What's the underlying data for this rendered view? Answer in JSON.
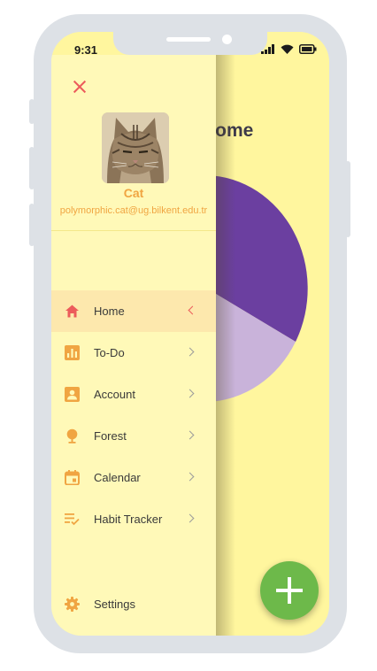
{
  "status": {
    "time": "9:31"
  },
  "page": {
    "title": "Home",
    "fab_icon": "plus-icon"
  },
  "user": {
    "name": "Cat",
    "email": "polymorphic.cat@ug.bilkent.edu.tr"
  },
  "menu": {
    "items": [
      {
        "label": "Home",
        "icon": "home-icon",
        "active": true
      },
      {
        "label": "To-Do",
        "icon": "chart-icon"
      },
      {
        "label": "Account",
        "icon": "account-icon"
      },
      {
        "label": "Forest",
        "icon": "tree-icon"
      },
      {
        "label": "Calendar",
        "icon": "calendar-icon"
      },
      {
        "label": "Habit Tracker",
        "icon": "checklist-icon"
      }
    ],
    "settings_label": "Settings"
  },
  "colors": {
    "drawer_bg": "#fff9b8",
    "active_bg": "#fde8ad",
    "accent_orange": "#f0a542",
    "close_red": "#ec5b5b",
    "home_red": "#ec5b5b",
    "fab_green": "#6db94a",
    "pie_primary": "#6b3fa0",
    "pie_secondary": "#c9b3da"
  }
}
